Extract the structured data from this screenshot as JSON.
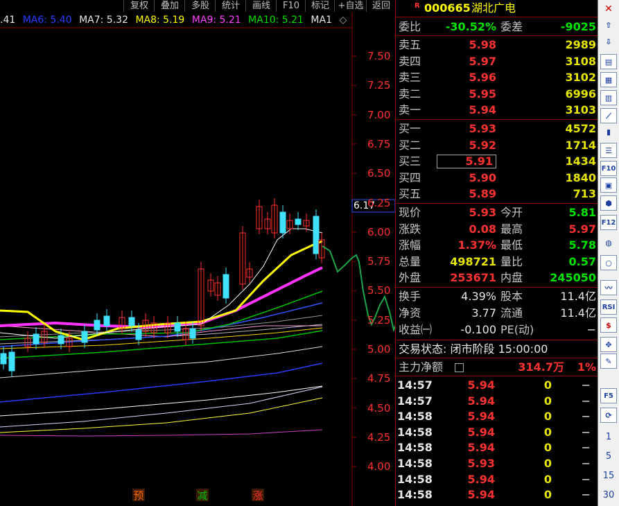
{
  "menu": [
    "复权",
    "叠加",
    "多股",
    "统计",
    "画线",
    "F10",
    "标记",
    "+自选",
    "返回"
  ],
  "ma_legend": [
    {
      "text": ".41",
      "color": "#e8e8e8"
    },
    {
      "text": "MA6: 5.40",
      "color": "#2a3cff"
    },
    {
      "text": "MA7: 5.32",
      "color": "#e8e8e8"
    },
    {
      "text": "MA8: 5.19",
      "color": "#ffff00"
    },
    {
      "text": "MA9: 5.21",
      "color": "#ff40ff"
    },
    {
      "text": "MA10: 5.21",
      "color": "#00e000"
    },
    {
      "text": "MA1",
      "color": "#e8e8e8"
    }
  ],
  "price_axis": [
    "7.50",
    "7.25",
    "7.00",
    "6.75",
    "6.50",
    "6.25",
    "6.00",
    "5.75",
    "5.50",
    "5.25",
    "5.00",
    "4.75",
    "4.50",
    "4.25",
    "4.00"
  ],
  "current_price_marker": "6.17",
  "markers": [
    {
      "label": "预",
      "color": "#ff6a00"
    },
    {
      "label": "减",
      "color": "#00c000"
    },
    {
      "label": "涨",
      "color": "#ff3030"
    }
  ],
  "stock": {
    "code": "000665",
    "name": "湖北广电",
    "badge": "R"
  },
  "ratio": {
    "label1": "委比",
    "value1": "-30.52%",
    "label2": "委差",
    "value2": "-9025"
  },
  "asks": [
    {
      "label": "卖五",
      "price": "5.98",
      "vol": "2989"
    },
    {
      "label": "卖四",
      "price": "5.97",
      "vol": "3108"
    },
    {
      "label": "卖三",
      "price": "5.96",
      "vol": "3102"
    },
    {
      "label": "卖二",
      "price": "5.95",
      "vol": "6996"
    },
    {
      "label": "卖一",
      "price": "5.94",
      "vol": "3103"
    }
  ],
  "bids": [
    {
      "label": "买一",
      "price": "5.93",
      "vol": "4572"
    },
    {
      "label": "买二",
      "price": "5.92",
      "vol": "1714"
    },
    {
      "label": "买三",
      "price": "5.91",
      "vol": "1434"
    },
    {
      "label": "买四",
      "price": "5.90",
      "vol": "1840"
    },
    {
      "label": "买五",
      "price": "5.89",
      "vol": "713"
    }
  ],
  "stats": [
    {
      "l1": "现价",
      "v1": "5.93",
      "c1": "red",
      "l2": "今开",
      "v2": "5.81",
      "c2": "green"
    },
    {
      "l1": "涨跌",
      "v1": "0.08",
      "c1": "red",
      "l2": "最高",
      "v2": "5.97",
      "c2": "red"
    },
    {
      "l1": "涨幅",
      "v1": "1.37%",
      "c1": "red",
      "l2": "最低",
      "v2": "5.78",
      "c2": "green"
    },
    {
      "l1": "总量",
      "v1": "498721",
      "c1": "yellow",
      "l2": "量比",
      "v2": "0.57",
      "c2": "green"
    },
    {
      "l1": "外盘",
      "v1": "253671",
      "c1": "red",
      "l2": "内盘",
      "v2": "245050",
      "c2": "green"
    }
  ],
  "fundamentals": [
    {
      "l1": "换手",
      "v1": "4.39%",
      "l2": "股本",
      "v2": "11.4亿"
    },
    {
      "l1": "净资",
      "v1": "3.77",
      "l2": "流通",
      "v2": "11.4亿"
    },
    {
      "l1": "收益㈠",
      "v1": "-0.100",
      "l2": "PE(动)",
      "v2": "−"
    }
  ],
  "trade_status": "交易状态: 闭市阶段 15:00:00",
  "main_force": {
    "label": "主力净额",
    "value": "314.7万",
    "pct": "1%"
  },
  "ticks": [
    {
      "time": "14:57",
      "price": "5.94",
      "vol": "0",
      "flag": "−"
    },
    {
      "time": "14:57",
      "price": "5.94",
      "vol": "0",
      "flag": "−"
    },
    {
      "time": "14:58",
      "price": "5.94",
      "vol": "0",
      "flag": "−"
    },
    {
      "time": "14:58",
      "price": "5.94",
      "vol": "0",
      "flag": "−"
    },
    {
      "time": "14:58",
      "price": "5.94",
      "vol": "0",
      "flag": "−"
    },
    {
      "time": "14:58",
      "price": "5.93",
      "vol": "0",
      "flag": "−"
    },
    {
      "time": "14:58",
      "price": "5.94",
      "vol": "0",
      "flag": "−"
    },
    {
      "time": "14:58",
      "price": "5.94",
      "vol": "0",
      "flag": "−"
    }
  ],
  "toolbar_icons": [
    "x-icon",
    "up-arrow-icon",
    "down-arrow-icon",
    "chart-icon",
    "grid-icon",
    "table-icon",
    "line-chart-icon",
    "bar-icon",
    "list-icon",
    "f10-icon",
    "info-icon",
    "pin-icon",
    "f12-icon",
    "circle-icon",
    "ring-icon",
    "wave-icon",
    "rsi-icon",
    "dollar-icon",
    "move-icon",
    "pencil-icon",
    "f5-icon",
    "refresh-icon"
  ],
  "toolbar_labels": {
    "rsi": "RSI",
    "f10": "F10",
    "f12": "F12",
    "f5": "F5"
  },
  "toolbar_periods": [
    "1",
    "5",
    "15",
    "30"
  ]
}
